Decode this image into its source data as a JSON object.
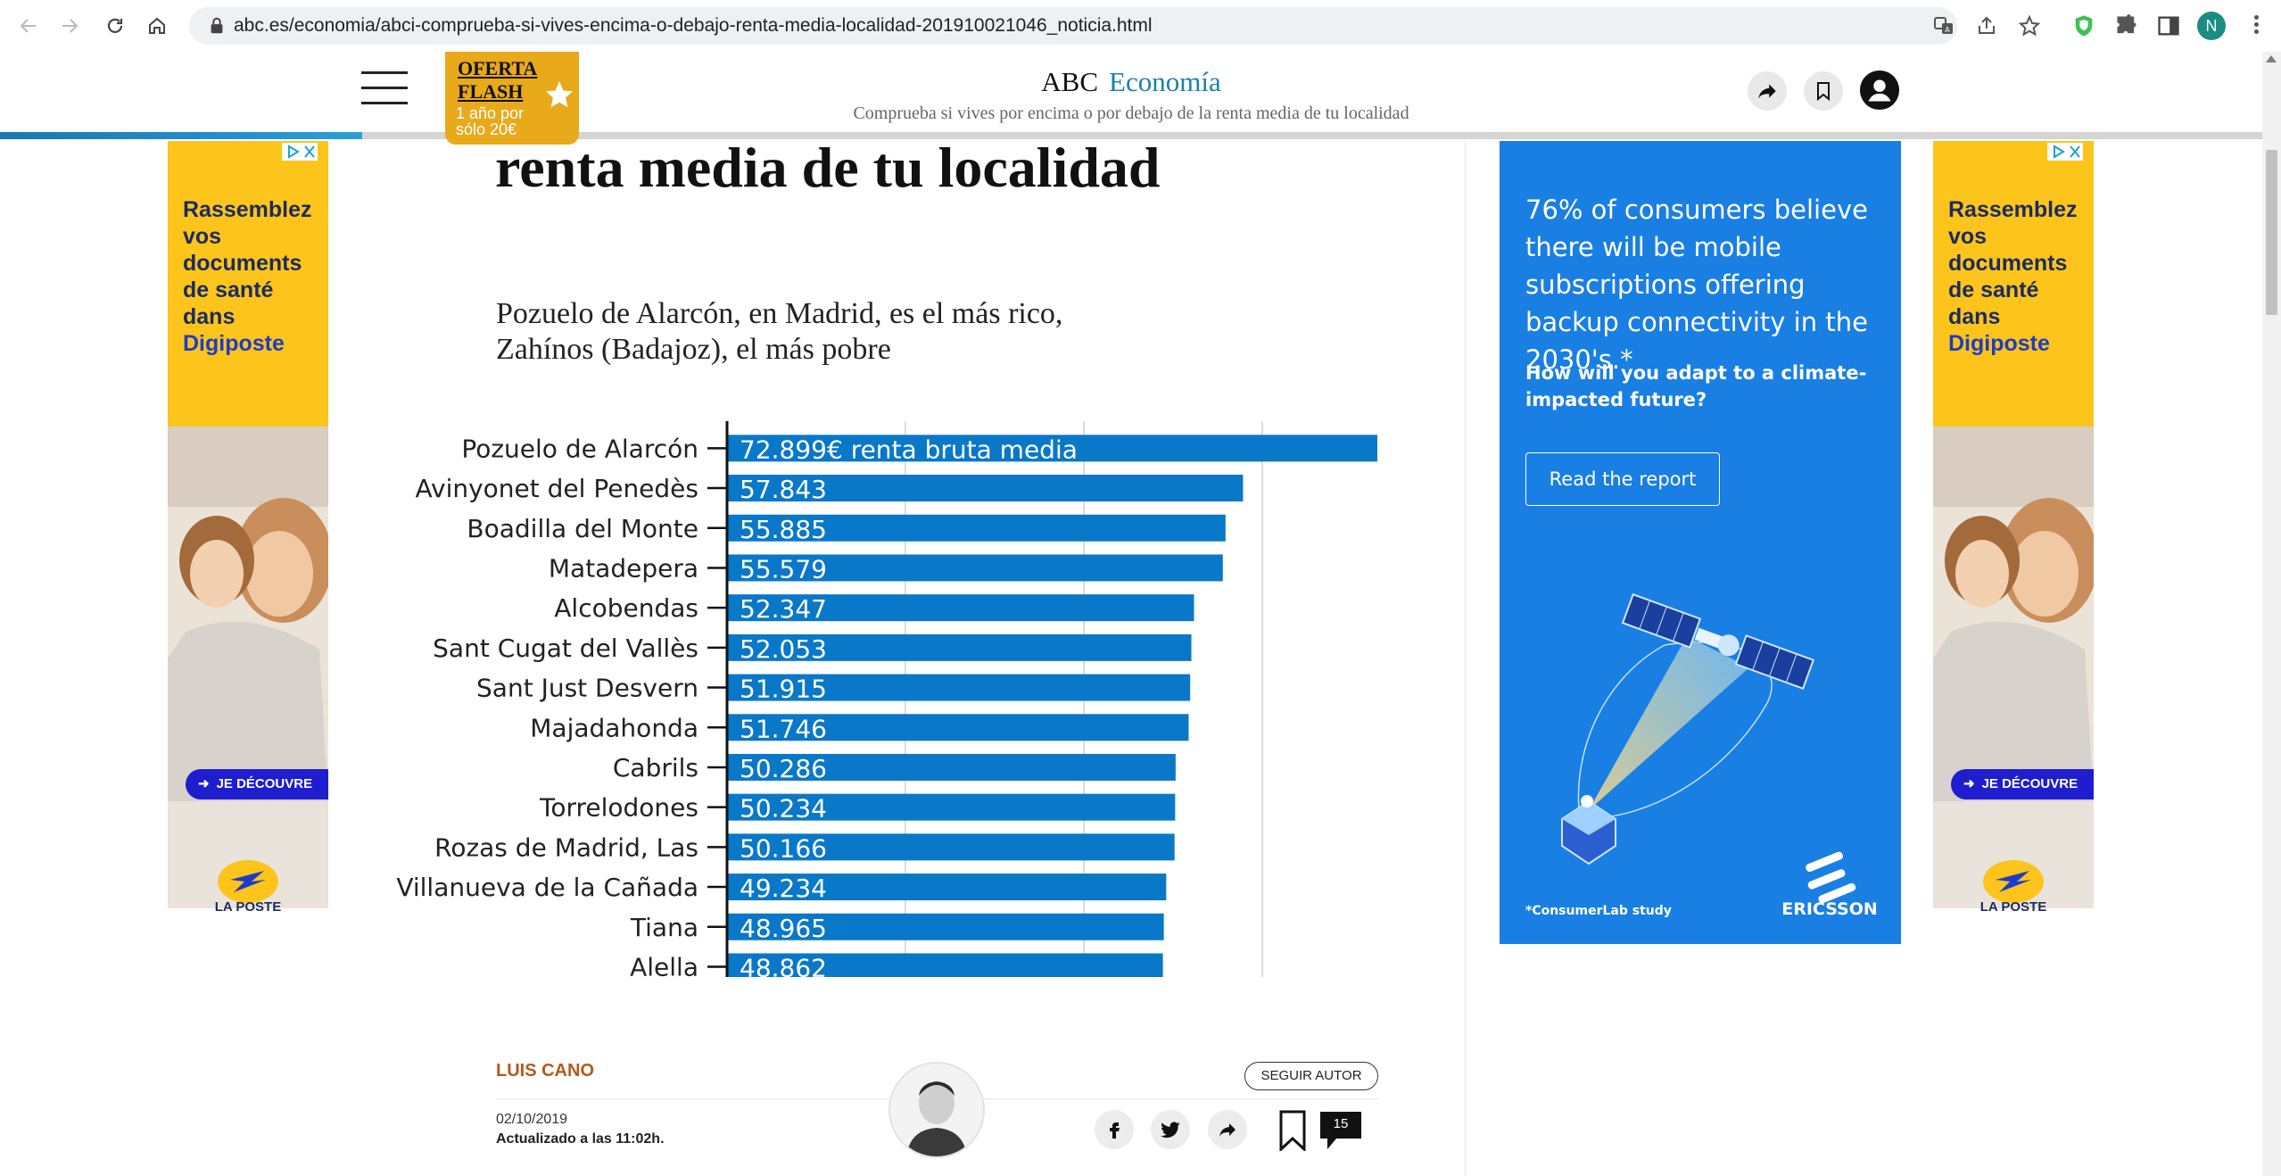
{
  "browser": {
    "url": "abc.es/economia/abci-comprueba-si-vives-encima-o-debajo-renta-media-localidad-201910021046_noticia.html",
    "profile_initial": "N"
  },
  "header": {
    "promo_title": "OFERTA FLASH",
    "promo_sub": "1 año por sólo 20€",
    "brand": "ABC",
    "section": "Economía",
    "subtitle": "Comprueba si vives por encima o por debajo de la renta media de tu localidad",
    "reading_progress": 0.16
  },
  "article": {
    "headline_tail": "renta media de tu localidad",
    "chart_subtitle_line1": "Pozuelo de Alarcón, en Madrid, es el más rico,",
    "chart_subtitle_line2": "Zahínos (Badajoz), el más pobre"
  },
  "chart_data": {
    "type": "bar",
    "orientation": "horizontal",
    "categories": [
      "Pozuelo de Alarcón",
      "Avinyonet del Penedès",
      "Boadilla del Monte",
      "Matadepera",
      "Alcobendas",
      "Sant Cugat del Vallès",
      "Sant Just Desvern",
      "Majadahonda",
      "Cabrils",
      "Torrelodones",
      "Rozas de Madrid, Las",
      "Villanueva de la Cañada",
      "Tiana",
      "Alella"
    ],
    "values": [
      72899,
      57843,
      55885,
      55579,
      52347,
      52053,
      51915,
      51746,
      50286,
      50234,
      50166,
      49234,
      48965,
      48862
    ],
    "labels": [
      "72.899€ renta bruta media",
      "57.843",
      "55.885",
      "55.579",
      "52.347",
      "52.053",
      "51.915",
      "51.746",
      "50.286",
      "50.234",
      "50.166",
      "49.234",
      "48.965",
      "48.862"
    ],
    "xlim": [
      0,
      80000
    ],
    "gridlines": [
      20000,
      40000,
      60000
    ],
    "grid": true,
    "color": "#0a78c8"
  },
  "ads": {
    "side": {
      "text": "Rassemblez vos documents de santé dans",
      "brand": "Digiposte",
      "cta": "JE DÉCOUVRE",
      "logo_label": "LA POSTE"
    },
    "right": {
      "text": "76% of consumers believe there will be mobile subscriptions offering backup connectivity in the 2030's.*",
      "question": "How will you adapt to a climate-impacted future?",
      "button": "Read the report",
      "footnote": "*ConsumerLab study",
      "brand": "ERICSSON"
    }
  },
  "byline": {
    "author": "LUIS CANO",
    "follow": "SEGUIR AUTOR",
    "date": "02/10/2019",
    "updated": "Actualizado a las 11:02h.",
    "comments": "15"
  },
  "colors": {
    "accent": "#1b7fb0",
    "promo": "#e8a91b",
    "bar": "#0a78c8",
    "author": "#b25a1e",
    "ericsson_blue": "#1a7fe3",
    "ad_yellow": "#fdc41c"
  },
  "icons": [
    "back-icon",
    "forward-icon",
    "reload-icon",
    "home-icon",
    "lock-icon",
    "translate-icon",
    "share-page-icon",
    "star-icon",
    "extension-icon",
    "puzzle-icon",
    "sidepanel-icon",
    "menu-icon",
    "share-icon",
    "bookmark-icon",
    "user-icon",
    "facebook-icon",
    "twitter-icon",
    "comment-icon"
  ]
}
